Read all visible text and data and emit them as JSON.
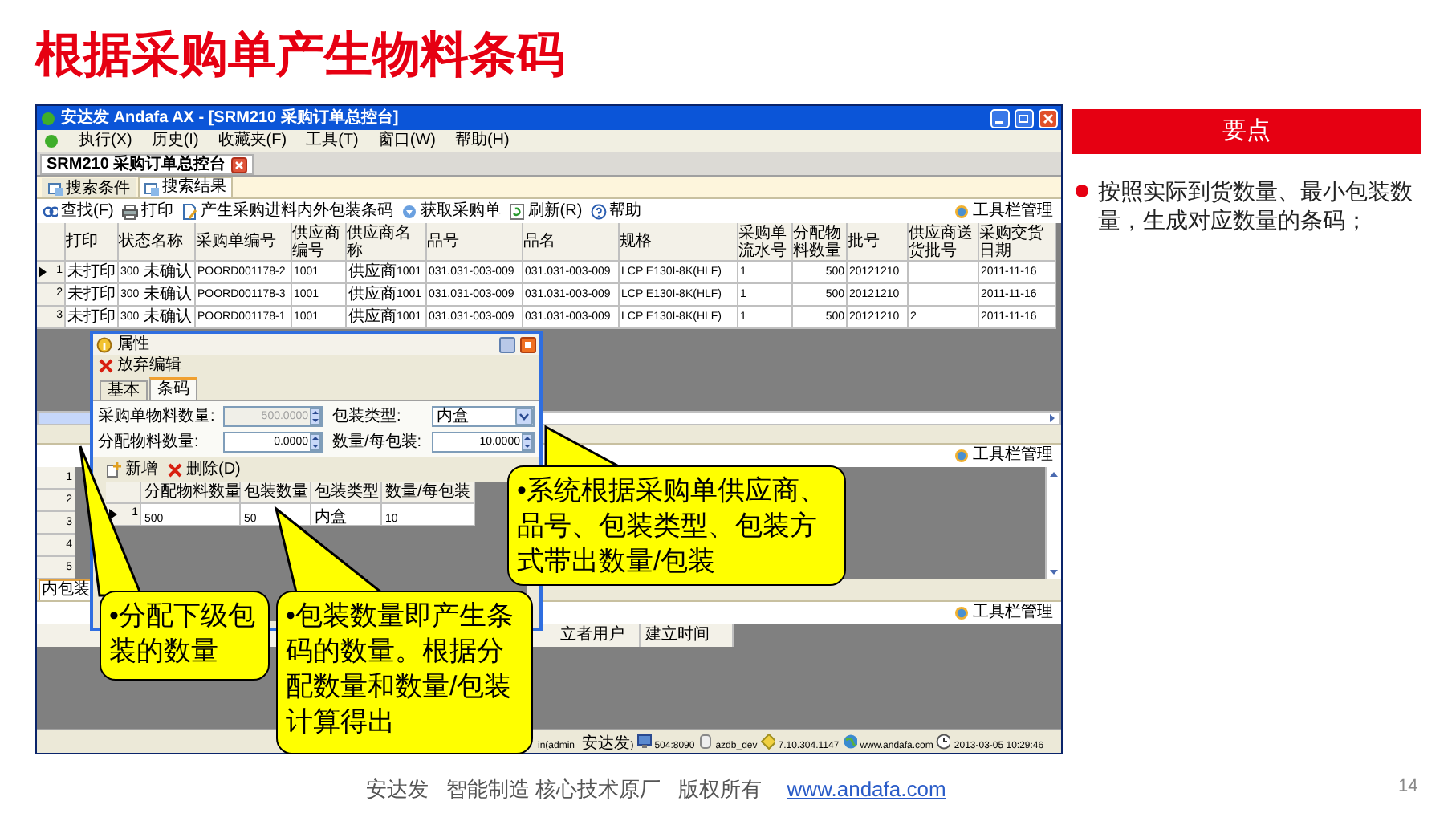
{
  "slide_title": "根据采购单产生物料条码",
  "window": {
    "title": "安达发 Andafa AX - [SRM210 采购订单总控台]",
    "menu": [
      "执行(X)",
      "历史(I)",
      "收藏夹(F)",
      "工具(T)",
      "窗口(W)",
      "帮助(H)"
    ],
    "document_tab": "SRM210 采购订单总控台",
    "tabs": [
      {
        "label": "搜索条件",
        "selected": false
      },
      {
        "label": "搜索结果",
        "selected": true
      }
    ],
    "toolbar": [
      "查找(F)",
      "打印",
      "产生采购进料内外包装条码",
      "获取采购单",
      "刷新(R)",
      "帮助"
    ],
    "toolbar_manager": "工具栏管理",
    "table": {
      "columns": [
        "打印",
        "状态名称",
        "采购单编号",
        "供应商编号",
        "供应商名称",
        "品号",
        "品名",
        "规格",
        "采购单流水号",
        "分配物料数量",
        "批号",
        "供应商送货批号",
        "采购交货日期"
      ],
      "rows": [
        {
          "row_number": "1",
          "current": true,
          "cells": [
            "未打印",
            "300 未确认",
            "POORD001178-2",
            "1001",
            "供应商1001",
            "031.031-003-009",
            "031.031-003-009",
            "LCP  E130I-8K(HLF)",
            "1",
            "500",
            "20121210",
            "",
            "2011-11-16"
          ]
        },
        {
          "row_number": "2",
          "current": false,
          "cells": [
            "未打印",
            "300 未确认",
            "POORD001178-3",
            "1001",
            "供应商1001",
            "031.031-003-009",
            "031.031-003-009",
            "LCP  E130I-8K(HLF)",
            "1",
            "500",
            "20121210",
            "",
            "2011-11-16"
          ]
        },
        {
          "row_number": "3",
          "current": false,
          "cells": [
            "未打印",
            "300 未确认",
            "POORD001178-1",
            "1001",
            "供应商1001",
            "031.031-003-009",
            "031.031-003-009",
            "LCP  E130I-8K(HLF)",
            "1",
            "500",
            "20121210",
            "2",
            "2011-11-16"
          ]
        }
      ]
    },
    "barcode_panel": {
      "toolbar_manager": "工具栏管理",
      "row_numbers": [
        "1",
        "2",
        "3",
        "4",
        "5"
      ]
    },
    "inner_panel": {
      "tab": "内包装",
      "toolbar_manager": "工具栏管理",
      "columns": [
        "立者用户",
        "建立时间"
      ]
    },
    "status_bar": [
      "in(admin 安达发)",
      "504:8090",
      "azdb_dev",
      "7.10.304.1147",
      "www.andafa.com",
      "2013-03-05 10:29:46"
    ]
  },
  "dialog": {
    "title": "属性",
    "toolbar": "放弃编辑",
    "tabs": [
      {
        "label": "基本",
        "selected": false
      },
      {
        "label": "条码",
        "selected": true
      }
    ],
    "fields": [
      {
        "label": "采购单物料数量:",
        "value": "500.0000",
        "kind": "spin",
        "disabled": true
      },
      {
        "label": "包装类型:",
        "value": "内盒",
        "kind": "select",
        "disabled": false
      },
      {
        "label": "分配物料数量:",
        "value": "0.0000",
        "kind": "spin",
        "disabled": false
      },
      {
        "label": "数量/每包装:",
        "value": "10.0000",
        "kind": "spin",
        "disabled": false
      }
    ],
    "grid_toolbar": [
      "新增",
      "删除(D)"
    ],
    "grid": {
      "columns": [
        "分配物料数量",
        "包装数量",
        "包装类型",
        "数量/每包装"
      ],
      "rows": [
        {
          "row_number": "1",
          "current": true,
          "cells": [
            "500",
            "50",
            "内盒",
            "10"
          ]
        }
      ]
    }
  },
  "callouts": [
    "•系统根据采购单供应商、品号、包装类型、包装方式带出数量/包装",
    "•分配下级包装的数量",
    "•包装数量即产生条码的数量。根据分配数量和数量/包装计算得出"
  ],
  "key_points": {
    "heading": "要点",
    "items": [
      "按照实际到货数量、最小包装数量，生成对应数量的条码；"
    ]
  },
  "footer": {
    "text": "安达发   智能制造 核心技术原厂   版权所有",
    "link": "www.andafa.com",
    "page": "14"
  }
}
